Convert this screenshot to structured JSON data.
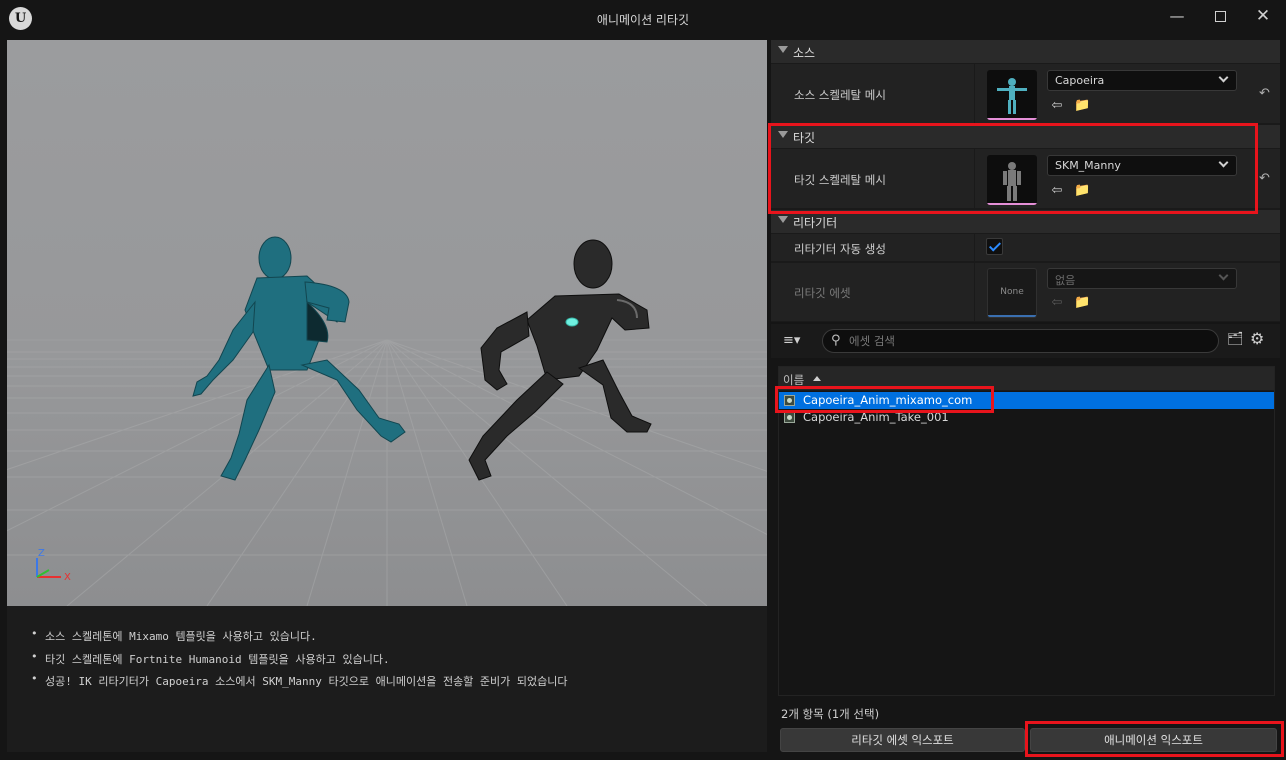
{
  "window": {
    "title": "애니메이션 리타깃",
    "logo": "U"
  },
  "viewport": {
    "axes": {
      "z": "Z",
      "x": "X"
    }
  },
  "log": {
    "lines": [
      "소스 스켈레톤에 Mixamo 템플릿을 사용하고 있습니다.",
      "타깃 스켈레톤에 Fortnite Humanoid 템플릿을 사용하고 있습니다.",
      "성공! IK 리타기터가 Capoeira 소스에서 SKM_Manny 타깃으로 애니메이션을 전송할 준비가 되었습니다"
    ]
  },
  "details": {
    "source": {
      "header": "소스",
      "label": "소스 스켈레탈 메시",
      "value": "Capoeira"
    },
    "target": {
      "header": "타깃",
      "label": "타깃 스켈레탈 메시",
      "value": "SKM_Manny"
    },
    "retargeter": {
      "header": "리타기터",
      "auto_label": "리타기터 자동 생성",
      "auto_checked": true,
      "asset_label": "리타깃 에셋",
      "asset_thumb": "None",
      "asset_value": "없음"
    }
  },
  "asset_browser": {
    "search_placeholder": "에셋 검색",
    "column_name": "이름",
    "items": [
      {
        "name": "Capoeira_Anim_mixamo_com",
        "selected": true
      },
      {
        "name": "Capoeira_Anim_Take_001",
        "selected": false
      }
    ],
    "count_text": "2개 항목 (1개 선택)"
  },
  "buttons": {
    "export_retarget": "리타깃 에셋 익스포트",
    "export_animation": "애니메이션 익스포트"
  },
  "colors": {
    "highlight": "#e8141c",
    "selection": "#0070e0",
    "source_mesh": "#1f6f7f",
    "target_mesh": "#2a2a2a"
  }
}
